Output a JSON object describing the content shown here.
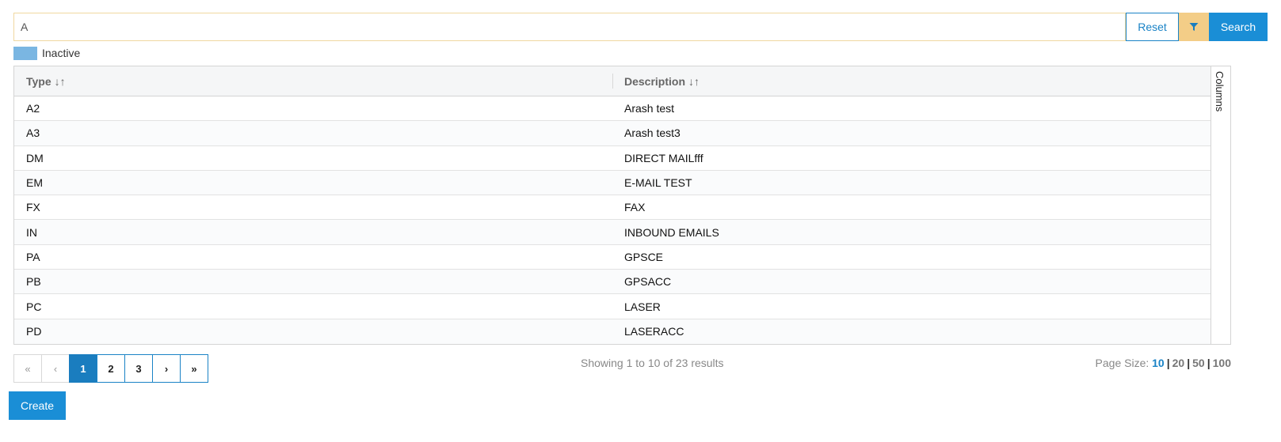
{
  "search": {
    "value": "A",
    "reset_label": "Reset",
    "search_label": "Search",
    "filter_icon": "funnel-icon"
  },
  "legend": {
    "label": "Inactive",
    "color": "#7ab6e2"
  },
  "table": {
    "columns": [
      {
        "label": "Type",
        "sort_icon": "↓↑"
      },
      {
        "label": "Description",
        "sort_icon": "↓↑"
      }
    ],
    "rows": [
      {
        "type": "A2",
        "description": "Arash test"
      },
      {
        "type": "A3",
        "description": "Arash test3"
      },
      {
        "type": "DM",
        "description": "DIRECT MAILfff"
      },
      {
        "type": "EM",
        "description": "E-MAIL TEST"
      },
      {
        "type": "FX",
        "description": "FAX"
      },
      {
        "type": "IN",
        "description": "INBOUND EMAILS"
      },
      {
        "type": "PA",
        "description": "GPSCE"
      },
      {
        "type": "PB",
        "description": "GPSACC"
      },
      {
        "type": "PC",
        "description": "LASER"
      },
      {
        "type": "PD",
        "description": "LASERACC"
      }
    ],
    "columns_tab_label": "Columns"
  },
  "pager": {
    "first": "«",
    "prev": "‹",
    "next": "›",
    "last": "»",
    "pages": [
      "1",
      "2",
      "3"
    ],
    "current": "1"
  },
  "status": {
    "showing": "Showing 1 to 10 of 23 results"
  },
  "page_size": {
    "label": "Page Size:",
    "options": [
      "10",
      "20",
      "50",
      "100"
    ],
    "selected": "10"
  },
  "actions": {
    "create_label": "Create"
  },
  "colors": {
    "accent": "#1a8ed6",
    "filter": "#f3cd87"
  }
}
